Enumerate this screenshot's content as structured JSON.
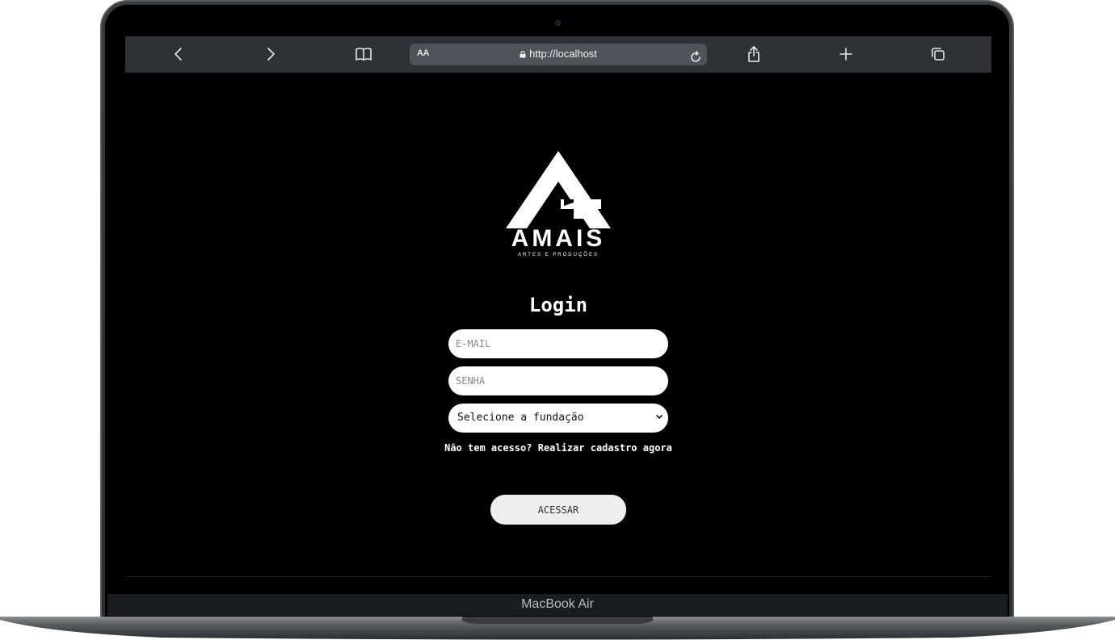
{
  "device": {
    "label": "MacBook Air"
  },
  "browser": {
    "text_size_label": "AA",
    "url": "http://localhost"
  },
  "brand": {
    "name": "AMAIS",
    "tagline": "ARTES E PRODUÇÕES"
  },
  "login": {
    "title": "Login",
    "email_placeholder": "E-MAIL",
    "password_placeholder": "SENHA",
    "foundation_select_value": "Selecione a fundação",
    "signup_link": "Não tem acesso? Realizar cadastro agora",
    "submit_label": "ACESSAR"
  },
  "colors": {
    "page_background": "#000000",
    "toolbar": "#2f3134",
    "input_background": "#ffffff",
    "button_background": "#eeeeee"
  }
}
